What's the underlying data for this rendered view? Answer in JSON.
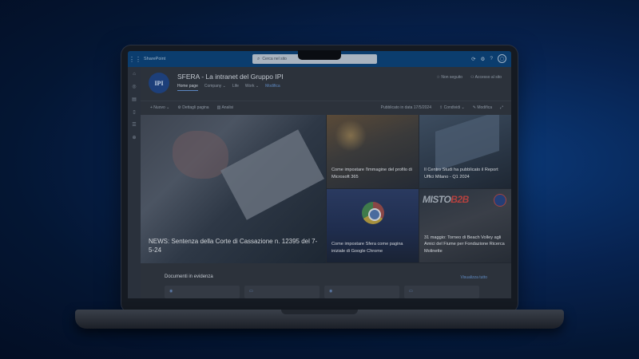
{
  "suitebar": {
    "brand": "SharePoint",
    "search_placeholder": "Cerca nel sito"
  },
  "site": {
    "logo_text": "IPI",
    "title": "SFERA - La intranet del Gruppo IPI",
    "nav": [
      "Home page",
      "Company",
      "Life",
      "Work",
      "Modifica"
    ],
    "actions": [
      "Non seguito",
      "Accesso al sito"
    ]
  },
  "commandbar": {
    "left": [
      "+ Nuovo",
      "Dettagli pagina",
      "Analisi"
    ],
    "right": [
      "Pubblicato in data 17/5/2024",
      "Condividi",
      "Modifica"
    ]
  },
  "news": [
    {
      "title": "NEWS: Sentenza della Corte di Cassazione n. 12395 del 7-5-24"
    },
    {
      "title": "Come impostare l'immagine del profilo di Microsoft 365"
    },
    {
      "title": "Il Centro Studi ha pubblicato il Report Uffici Milano - Q1 2024"
    },
    {
      "title": "Come impostare Sfera come pagina iniziale di Google Chrome"
    },
    {
      "title": "31 maggio: Torneo di Beach Volley agli Amici del Fiume per Fondazione Ricerca Molinette"
    }
  ],
  "misto_b2b": {
    "word1": "MISTO",
    "word2": "B2B"
  },
  "documents": {
    "title": "Documenti in evidenza",
    "view_all": "Visualizza tutto"
  },
  "colors": {
    "suitebar": "#0b3d6e",
    "accent": "#5f8ac2"
  }
}
